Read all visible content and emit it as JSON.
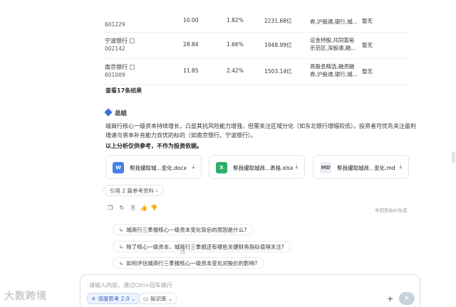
{
  "table": {
    "rows": [
      {
        "name": "",
        "code": "601229",
        "val1": "10.00",
        "pct": "1.82%",
        "cap": "2231.68亿",
        "tags": "券,沪股通,银行,城...",
        "status": "暂无"
      },
      {
        "name": "宁波银行",
        "code": "002142",
        "val1": "28.84",
        "pct": "1.66%",
        "cap": "1948.99亿",
        "tags": "证金持股,共同富裕示范区,深股通,融...",
        "status": "暂无"
      },
      {
        "name": "南京银行",
        "code": "601009",
        "val1": "11.85",
        "pct": "2.42%",
        "cap": "1503.14亿",
        "tags": "高股息精选,融资融券,沪股通,银行,城...",
        "status": "暂无"
      }
    ]
  },
  "more_results": "查看17条结果",
  "summary": {
    "title": "总结",
    "paragraph": "城商行核心一级资本持续增长，凸显其抗风险能力增强，但需关注区域分化（如东北银行增幅较低）。投资者可优先关注盈利增速与资本补充能力双优的标的（如南京银行、宁波银行）。",
    "disclaimer": "以上分析仅供参考，不作为投资依据。"
  },
  "files": [
    {
      "name": "帮我撮取城...变化.docx",
      "icon": "word-doc-icon",
      "icon_label": "W",
      "color": "#4a7ee8"
    },
    {
      "name": "帮我撮取城商...表格.xlsx",
      "icon": "excel-sheet-icon",
      "icon_label": "X",
      "color": "#2faf6a"
    },
    {
      "name": "帮我撮取城商...变化.md",
      "icon": "markdown-file-icon",
      "icon_label": "MD",
      "color": "#e9ecf1"
    }
  ],
  "references": "引用 2 篇参考资料 ›",
  "ai_note": "本回答由AI生成",
  "suggestions": [
    "城商行三季报核心一级资本变化背后的原因是什么?",
    "除了核心一级资本，城商行三季报还有哪些关键财务指标值得关注?",
    "如何评估城商行三季报核心一级资本变化对股价的影响?"
  ],
  "input": {
    "placeholder": "请输入内容，通过Ctrl+回车换行",
    "deep_think_label": "深度思考 2.0 ⌄",
    "kb_label": "知识库 ⌄"
  },
  "watermark": "大数跨境"
}
